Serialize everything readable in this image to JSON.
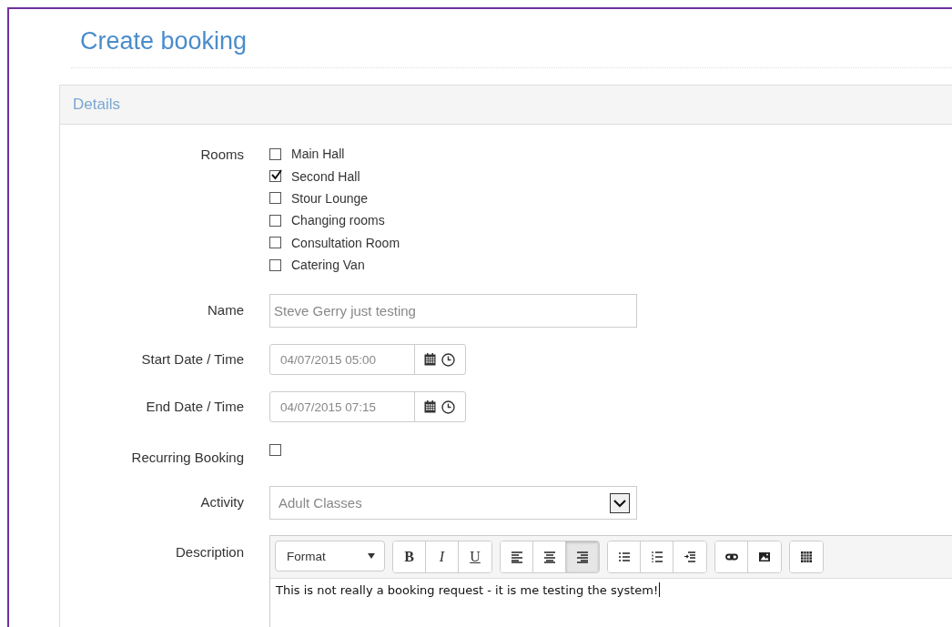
{
  "page": {
    "title": "Create booking"
  },
  "panel": {
    "heading": "Details"
  },
  "rooms": {
    "label": "Rooms",
    "options": [
      {
        "label": "Main Hall",
        "checked": false
      },
      {
        "label": "Second Hall",
        "checked": true
      },
      {
        "label": "Stour Lounge",
        "checked": false
      },
      {
        "label": "Changing rooms",
        "checked": false
      },
      {
        "label": "Consultation Room",
        "checked": false
      },
      {
        "label": "Catering Van",
        "checked": false
      }
    ]
  },
  "name": {
    "label": "Name",
    "value": "Steve Gerry just testing"
  },
  "start": {
    "label": "Start Date / Time",
    "value": "04/07/2015 05:00"
  },
  "end": {
    "label": "End Date / Time",
    "value": "04/07/2015 07:15"
  },
  "recurring": {
    "label": "Recurring Booking",
    "checked": false
  },
  "activity": {
    "label": "Activity",
    "value": "Adult Classes"
  },
  "description": {
    "label": "Description",
    "format": "Format",
    "toolbar": [
      [
        {
          "kind": "bold",
          "text": "B",
          "selected": false
        },
        {
          "kind": "italic",
          "text": "I",
          "selected": false
        },
        {
          "kind": "underline",
          "text": "U",
          "selected": false
        }
      ],
      [
        {
          "kind": "align-left",
          "selected": false
        },
        {
          "kind": "align-center",
          "selected": false
        },
        {
          "kind": "align-right",
          "selected": true
        }
      ],
      [
        {
          "kind": "bulleted-list",
          "selected": false
        },
        {
          "kind": "numbered-list",
          "selected": false
        },
        {
          "kind": "indent",
          "selected": false
        }
      ],
      [
        {
          "kind": "link",
          "selected": false
        },
        {
          "kind": "image",
          "selected": false
        }
      ],
      [
        {
          "kind": "table",
          "selected": false
        }
      ]
    ],
    "content": "This is not really a booking request - it is me testing the system!"
  }
}
